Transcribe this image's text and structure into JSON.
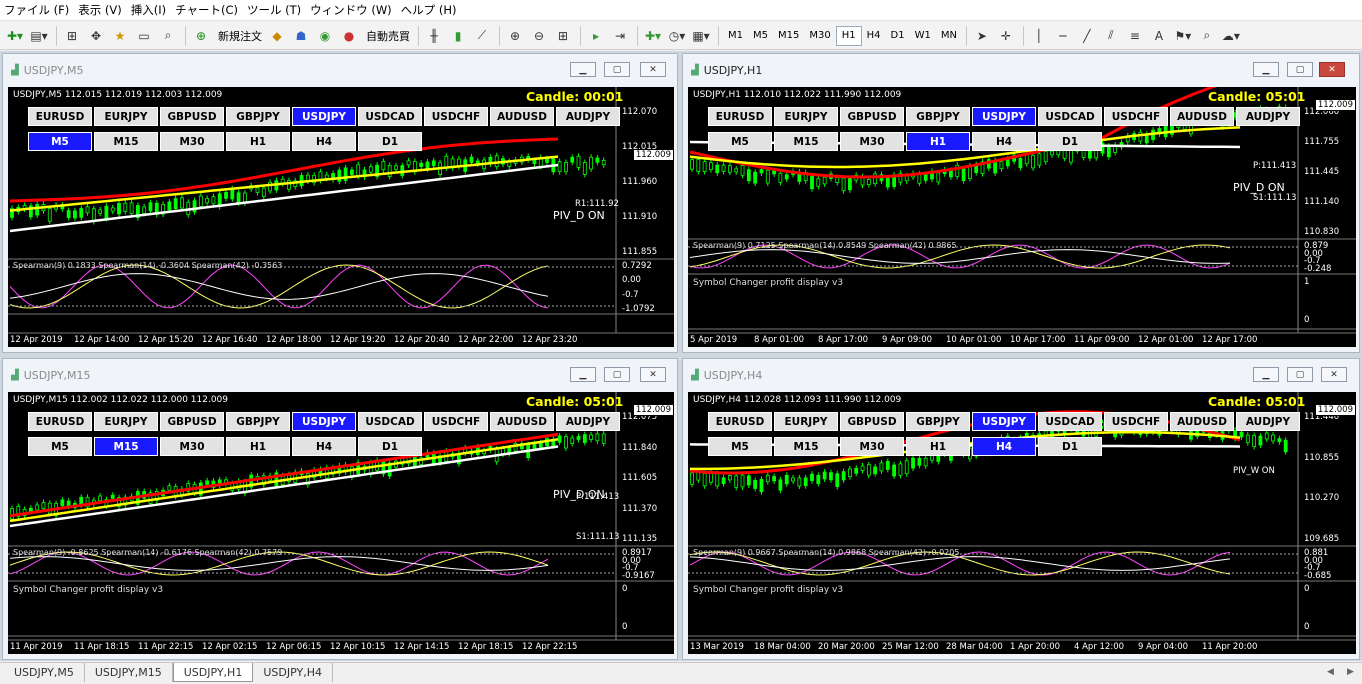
{
  "menu": [
    "ファイル (F)",
    "表示 (V)",
    "挿入(I)",
    "チャート(C)",
    "ツール (T)",
    "ウィンドウ (W)",
    "ヘルプ (H)"
  ],
  "toolbar": {
    "new_order": "新規注文",
    "auto_trade": "自動売買",
    "timeframes": [
      "M1",
      "M5",
      "M15",
      "M30",
      "H1",
      "H4",
      "D1",
      "W1",
      "MN"
    ],
    "active_timeframe": "H1"
  },
  "symbols": [
    "EURUSD",
    "EURJPY",
    "GBPUSD",
    "GBPJPY",
    "USDJPY",
    "USDCAD",
    "USDCHF",
    "AUDUSD",
    "AUDJPY"
  ],
  "selected_symbol": "USDJPY",
  "periods": [
    "M5",
    "M15",
    "M30",
    "H1",
    "H4",
    "D1"
  ],
  "windows": [
    {
      "title": "USDJPY,M5",
      "header": "USDJPY,M5  112.015 112.019 112.003 112.009",
      "candle": "Candle:  00:01",
      "period": "M5",
      "badge": "112.009",
      "prices": [
        "112.070",
        "112.015",
        "111.960",
        "111.910",
        "111.855"
      ],
      "labels": [
        "R1:111.92",
        "PIV_D ON"
      ],
      "indicator": "Spearman(9) 0.1833  Spearman(14) -0.3604  Spearman(42) -0.3563",
      "ind_scale": [
        "0.7292",
        "0.00",
        "-0.7",
        "-1.0792"
      ],
      "xaxis": [
        "12 Apr 2019",
        "12 Apr 14:00",
        "12 Apr 15:20",
        "12 Apr 16:40",
        "12 Apr 18:00",
        "12 Apr 19:20",
        "12 Apr 20:40",
        "12 Apr 22:00",
        "12 Apr 23:20"
      ]
    },
    {
      "title": "USDJPY,H1",
      "header": "USDJPY,H1  112.010 112.022 111.990 112.009",
      "candle": "Candle:  05:01",
      "period": "H1",
      "badge": "112.009",
      "prices": [
        "112.060",
        "111.755",
        "111.445",
        "111.140",
        "110.830"
      ],
      "labels": [
        "P:111.413",
        "PIV_D ON",
        "S1:111.13"
      ],
      "indicator": "Spearman(9) 0.7125  Spearman(14) 0.8549  Spearman(42) 0.9865",
      "ind_scale": [
        "0.879",
        "0.00",
        "-0.7",
        "-0.248"
      ],
      "panel": "Symbol Changer profit display v3",
      "panel_scale": [
        "1",
        "0"
      ],
      "xaxis": [
        "5 Apr 2019",
        "8 Apr 01:00",
        "8 Apr 17:00",
        "9 Apr 09:00",
        "10 Apr 01:00",
        "10 Apr 17:00",
        "11 Apr 09:00",
        "12 Apr 01:00",
        "12 Apr 17:00"
      ]
    },
    {
      "title": "USDJPY,M15",
      "header": "USDJPY,M15  112.002 112.022 112.000 112.009",
      "candle": "Candle:  05:01",
      "period": "M15",
      "badge": "112.009",
      "prices": [
        "112.075",
        "111.840",
        "111.605",
        "111.370",
        "111.135"
      ],
      "labels": [
        "PIV_D ON",
        "P:111.413",
        "S1:111.13"
      ],
      "indicator": "Spearman(9) -0.8625  Spearman(14) -0.6176  Spearman(42) 0.7579",
      "ind_scale": [
        "0.8917",
        "0.00",
        "-0.7",
        "-0.9167"
      ],
      "panel": "Symbol Changer profit display v3",
      "panel_scale": [
        "0",
        "0"
      ],
      "xaxis": [
        "11 Apr 2019",
        "11 Apr 18:15",
        "11 Apr 22:15",
        "12 Apr 02:15",
        "12 Apr 06:15",
        "12 Apr 10:15",
        "12 Apr 14:15",
        "12 Apr 18:15",
        "12 Apr 22:15"
      ]
    },
    {
      "title": "USDJPY,H4",
      "header": "USDJPY,H4  112.028 112.093 111.990 112.009",
      "candle": "Candle:  05:01",
      "period": "H4",
      "badge": "112.009",
      "prices": [
        "111.440",
        "110.855",
        "110.270",
        "109.685"
      ],
      "labels": [
        "PIV_W ON"
      ],
      "indicator": "Spearman(9) 0.9667  Spearman(14) 0.9868  Spearman(42) -0.0205",
      "ind_scale": [
        "0.881",
        "0.00",
        "-0.7",
        "-0.685"
      ],
      "panel": "Symbol Changer profit display v3",
      "panel_scale": [
        "0",
        "0"
      ],
      "xaxis": [
        "13 Mar 2019",
        "18 Mar 04:00",
        "20 Mar 20:00",
        "25 Mar 12:00",
        "28 Mar 04:00",
        "1 Apr 20:00",
        "4 Apr 12:00",
        "9 Apr 04:00",
        "11 Apr 20:00"
      ]
    }
  ],
  "tabs": [
    "USDJPY,M5",
    "USDJPY,M15",
    "USDJPY,H1",
    "USDJPY,H4"
  ],
  "active_tab": "USDJPY,H1",
  "colors": {
    "bg": "#000000",
    "candle_up": "#00ff00",
    "ma_red": "#ff0000",
    "ma_yellow": "#ffff00",
    "ma_white": "#ffffff",
    "selected": "#1a1aff"
  }
}
